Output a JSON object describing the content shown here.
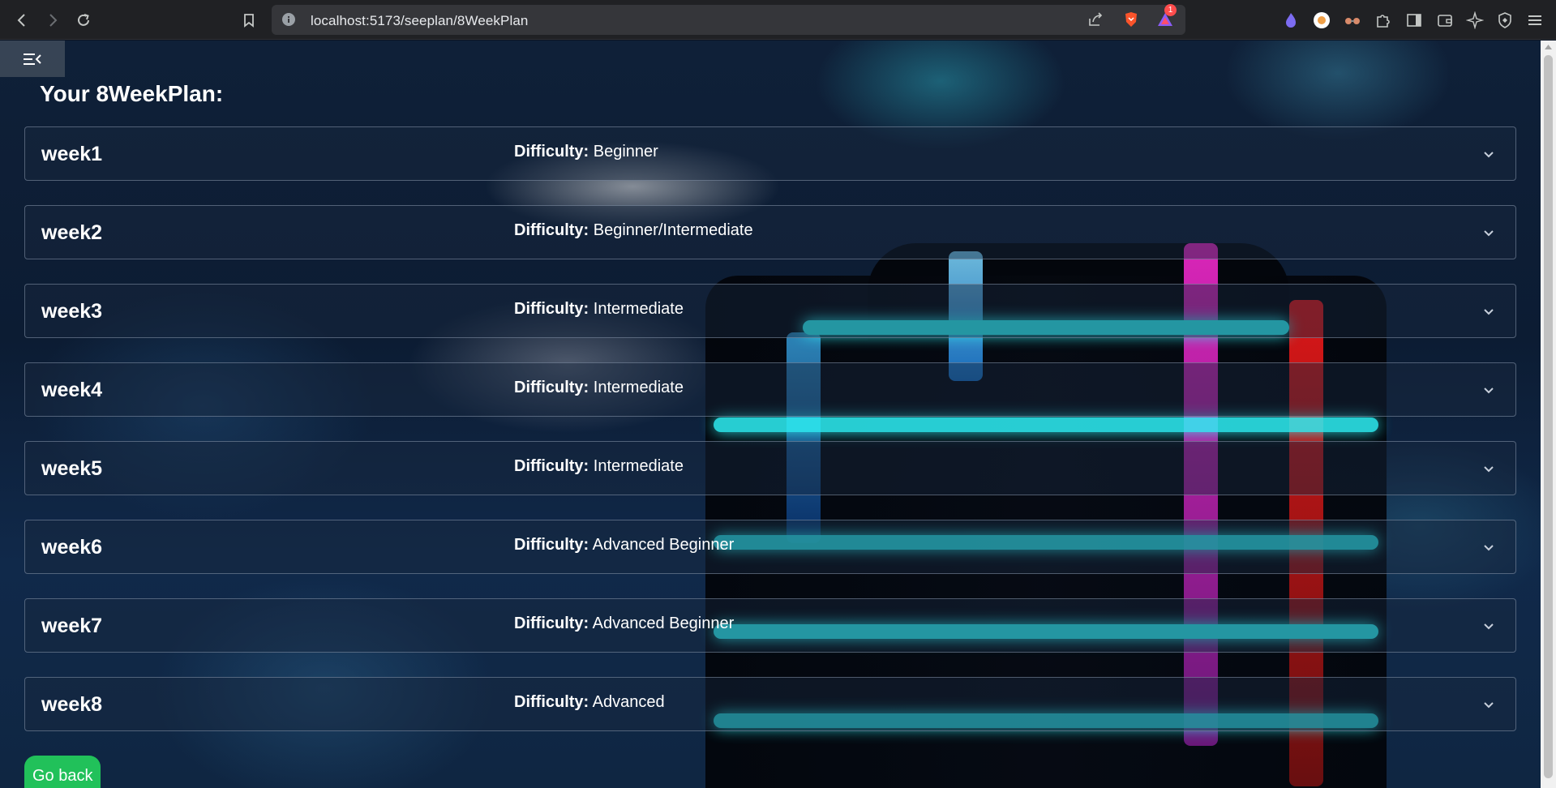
{
  "browser": {
    "url": "localhost:5173/seeplan/8WeekPlan",
    "notification_count": "1"
  },
  "page": {
    "title": "Your 8WeekPlan:",
    "difficulty_label": "Difficulty:",
    "weeks": [
      {
        "name": "week1",
        "difficulty": "Beginner"
      },
      {
        "name": "week2",
        "difficulty": "Beginner/Intermediate"
      },
      {
        "name": "week3",
        "difficulty": "Intermediate"
      },
      {
        "name": "week4",
        "difficulty": "Intermediate"
      },
      {
        "name": "week5",
        "difficulty": "Intermediate"
      },
      {
        "name": "week6",
        "difficulty": "Advanced Beginner"
      },
      {
        "name": "week7",
        "difficulty": "Advanced Beginner"
      },
      {
        "name": "week8",
        "difficulty": "Advanced"
      }
    ],
    "go_back_label": "Go back"
  },
  "colors": {
    "go_back": "#21c15a",
    "glow": "#2ef0f5"
  }
}
